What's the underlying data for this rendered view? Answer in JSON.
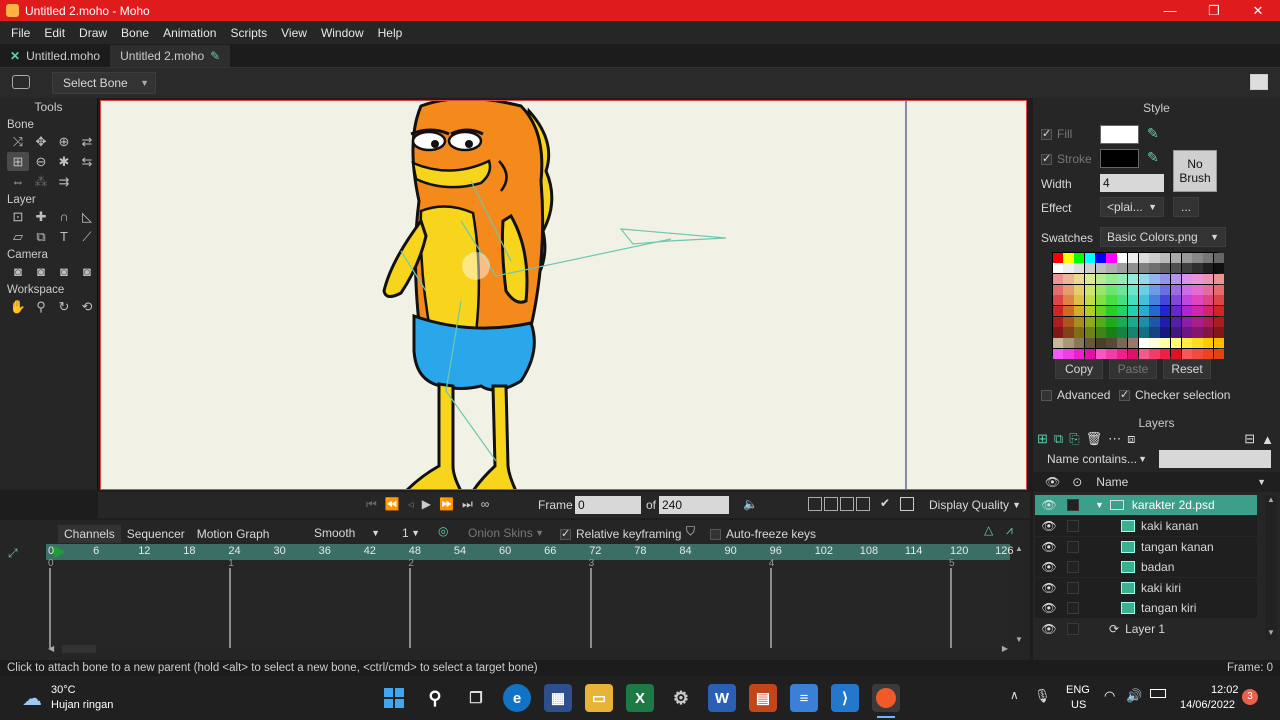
{
  "window": {
    "title": "Untitled 2.moho - Moho",
    "minimize": "—",
    "maximize": "❐",
    "close": "✕"
  },
  "menu": [
    "File",
    "Edit",
    "Draw",
    "Bone",
    "Animation",
    "Scripts",
    "View",
    "Window",
    "Help"
  ],
  "tabs": [
    {
      "label": "Untitled.moho",
      "close": "✕"
    },
    {
      "label": "Untitled 2.moho",
      "edit": "✎"
    }
  ],
  "tool_options": {
    "tool_select": "Select Bone"
  },
  "tools_panel": {
    "title": "Tools",
    "sections": {
      "bone": "Bone",
      "layer": "Layer",
      "camera": "Camera",
      "workspace": "Workspace"
    }
  },
  "style_panel": {
    "title": "Style",
    "fill_label": "Fill",
    "stroke_label": "Stroke",
    "no_brush_line1": "No",
    "no_brush_line2": "Brush",
    "width_label": "Width",
    "width_value": "4",
    "effect_label": "Effect",
    "effect_value": "<plai...",
    "effect_more": "...",
    "swatches_label": "Swatches",
    "swatches_value": "Basic Colors.png",
    "copy": "Copy",
    "paste": "Paste",
    "reset": "Reset",
    "advanced": "Advanced",
    "checker": "Checker selection",
    "fill_color": "#ffffff",
    "stroke_color": "#000000"
  },
  "layers_panel": {
    "title": "Layers",
    "filter": "Name contains...",
    "name_col": "Name",
    "layers": [
      {
        "name": "karakter 2d.psd"
      },
      {
        "name": "kaki kanan"
      },
      {
        "name": "tangan kanan"
      },
      {
        "name": "badan"
      },
      {
        "name": "kaki kiri"
      },
      {
        "name": "tangan kiri"
      },
      {
        "name": "Layer 1"
      }
    ]
  },
  "playback": {
    "frame_label": "Frame",
    "frame_value": "0",
    "of_label": "of",
    "total_frames": "240",
    "display_quality": "Display Quality"
  },
  "timeline": {
    "tabs": [
      "Channels",
      "Sequencer",
      "Motion Graph"
    ],
    "interp": "Smooth",
    "interp_num": "1",
    "onion": "Onion Skins",
    "relative": "Relative keyframing",
    "autofreeze": "Auto-freeze keys",
    "ruler": [
      "0",
      "6",
      "12",
      "18",
      "24",
      "30",
      "36",
      "42",
      "48",
      "54",
      "60",
      "66",
      "72",
      "78",
      "84",
      "90",
      "96",
      "102",
      "108",
      "114",
      "120",
      "126"
    ],
    "seconds": [
      "0",
      "1",
      "2",
      "3",
      "4",
      "5"
    ]
  },
  "status": {
    "message": "Click to attach bone to a new parent (hold <alt> to select a new bone, <ctrl/cmd> to select a target bone)",
    "frame": "Frame: 0"
  },
  "taskbar": {
    "temp": "30°C",
    "weather": "Hujan ringan",
    "lang1": "ENG",
    "lang2": "US",
    "time": "12:02",
    "date": "14/06/2022",
    "badge": "3"
  }
}
